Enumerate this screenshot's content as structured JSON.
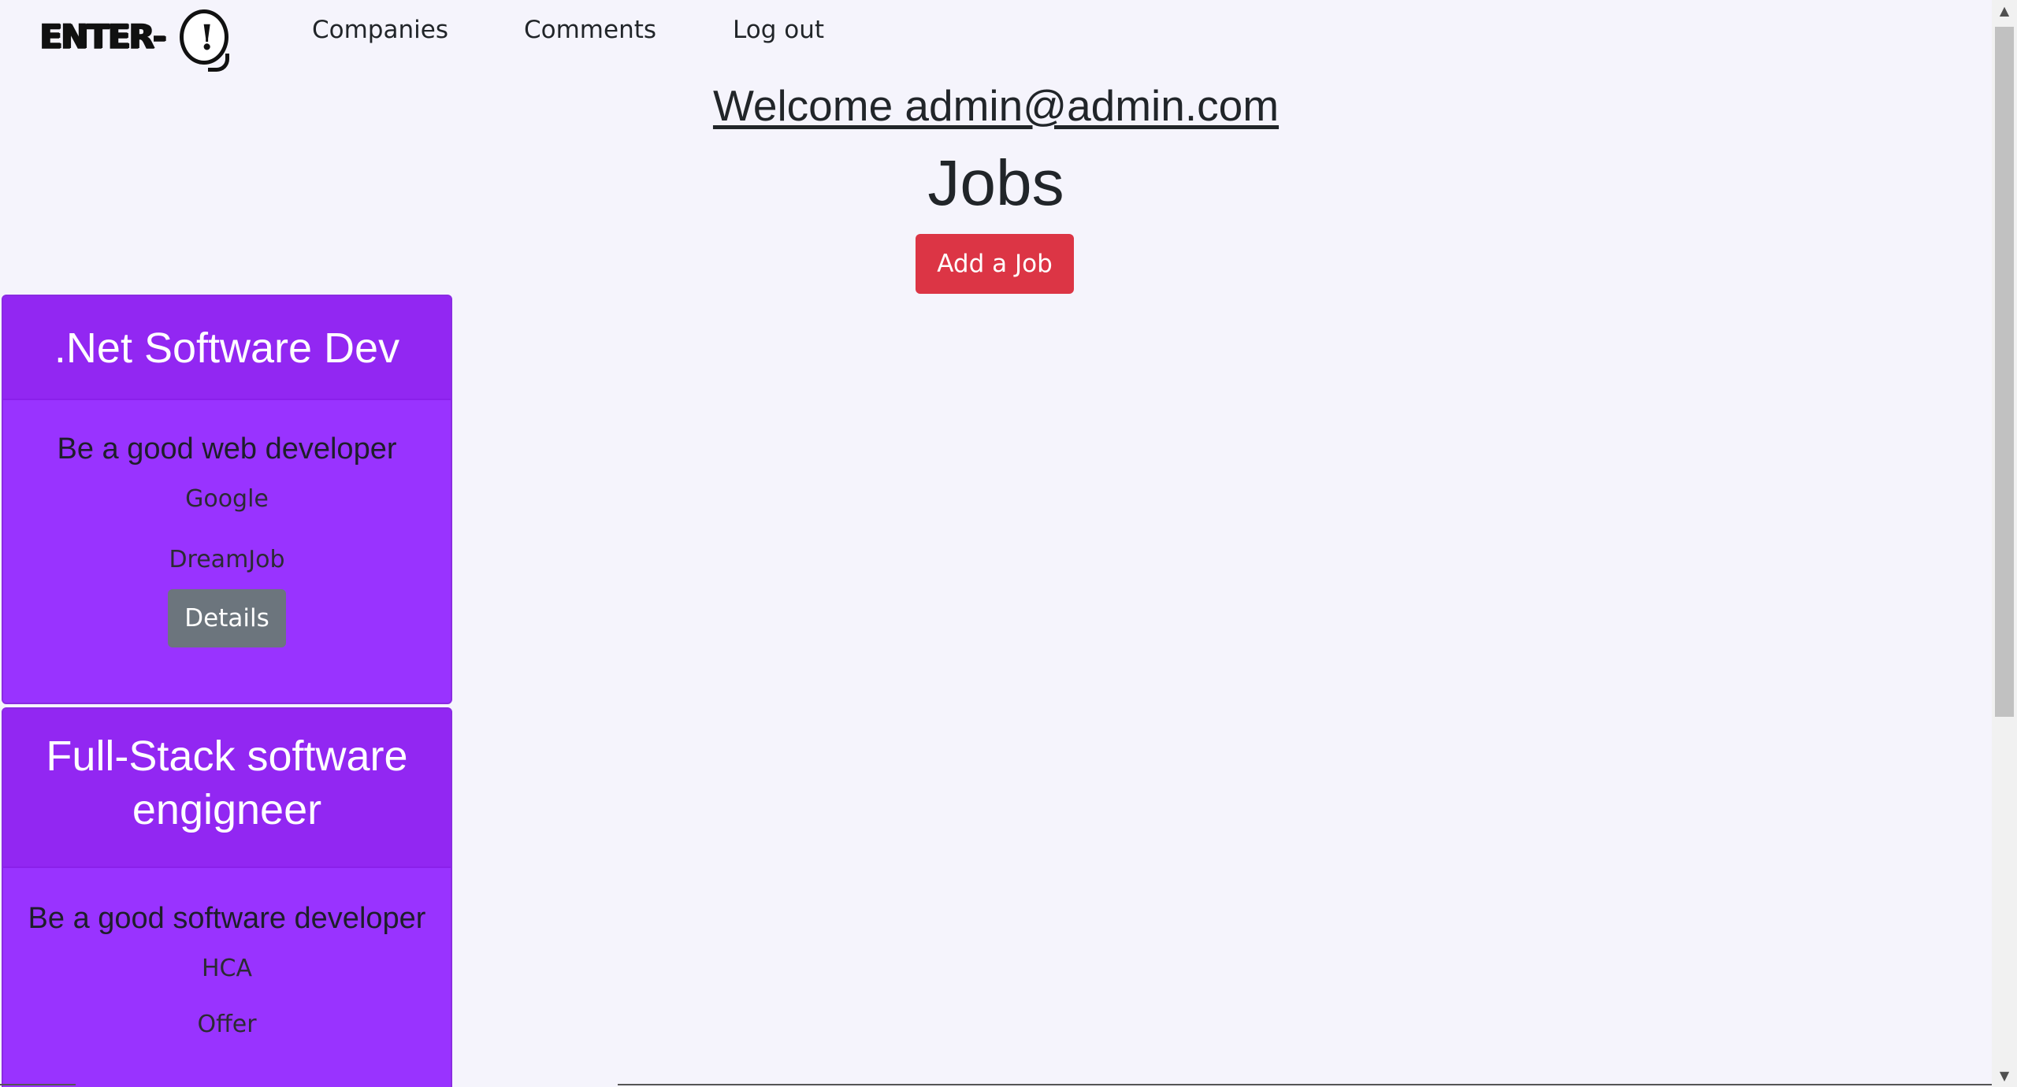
{
  "navbar": {
    "logo_text": "ENTER-",
    "logo_symbol": "!",
    "links": [
      {
        "label": "Companies"
      },
      {
        "label": "Comments"
      },
      {
        "label": "Log out"
      }
    ]
  },
  "header": {
    "welcome": "Welcome admin@admin.com",
    "title": "Jobs",
    "add_button": "Add a Job"
  },
  "jobs": [
    {
      "title": ".Net Software Dev",
      "description": "Be a good web developer",
      "company": "Google",
      "category": "DreamJob",
      "details_label": "Details"
    },
    {
      "title": "Full-Stack software engigneer",
      "description": "Be a good software developer",
      "company": "HCA",
      "category": "Offer"
    }
  ],
  "colors": {
    "background": "#f5f4fc",
    "card": "#9933ff",
    "card_header": "#9227f2",
    "add_button": "#dc3545",
    "details_button": "#6c757d"
  },
  "icons": {
    "scroll_up": "scroll-up-arrow-icon",
    "scroll_down": "scroll-down-arrow-icon"
  }
}
